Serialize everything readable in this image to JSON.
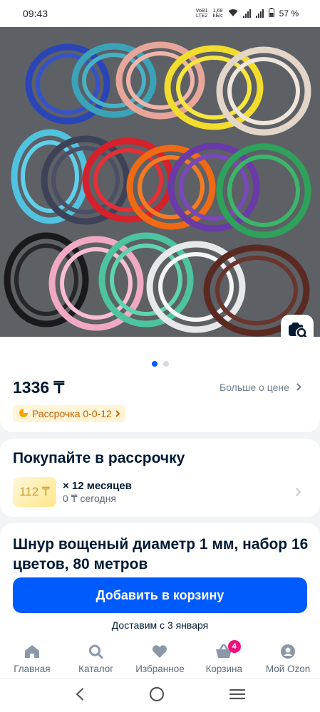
{
  "status_bar": {
    "time": "09:43",
    "network_top": "VoB1",
    "network_bottom": "LTE2",
    "speed_top": "1,69",
    "speed_bottom": "КБ/с",
    "battery": "57 %"
  },
  "gallery": {
    "page_count": 2,
    "active_page": 1
  },
  "price_block": {
    "price": "1336 ₸",
    "more_price_link": "Больше о цене",
    "installment_badge": "Рассрочка 0-0-12"
  },
  "installment": {
    "title": "Покупайте в рассрочку",
    "amount": "112 ₸",
    "months": "× 12 месяцев",
    "today": "0 ₸ сегодня"
  },
  "product": {
    "title": "Шнур вощеный диаметр 1 мм, набор 16 цветов, 80 метров"
  },
  "actions": {
    "add_to_cart": "Добавить в корзину",
    "delivery": "Доставим с 3 января"
  },
  "tabbar": {
    "items": [
      {
        "label": "Главная",
        "icon": "home-icon"
      },
      {
        "label": "Каталог",
        "icon": "search-icon"
      },
      {
        "label": "Избранное",
        "icon": "heart-icon"
      },
      {
        "label": "Корзина",
        "icon": "cart-icon",
        "badge": "4"
      },
      {
        "label": "Мой Ozon",
        "icon": "user-icon"
      }
    ]
  },
  "colors": {
    "accent": "#005bff",
    "badge": "#f1117e",
    "installment_text": "#c26100"
  }
}
